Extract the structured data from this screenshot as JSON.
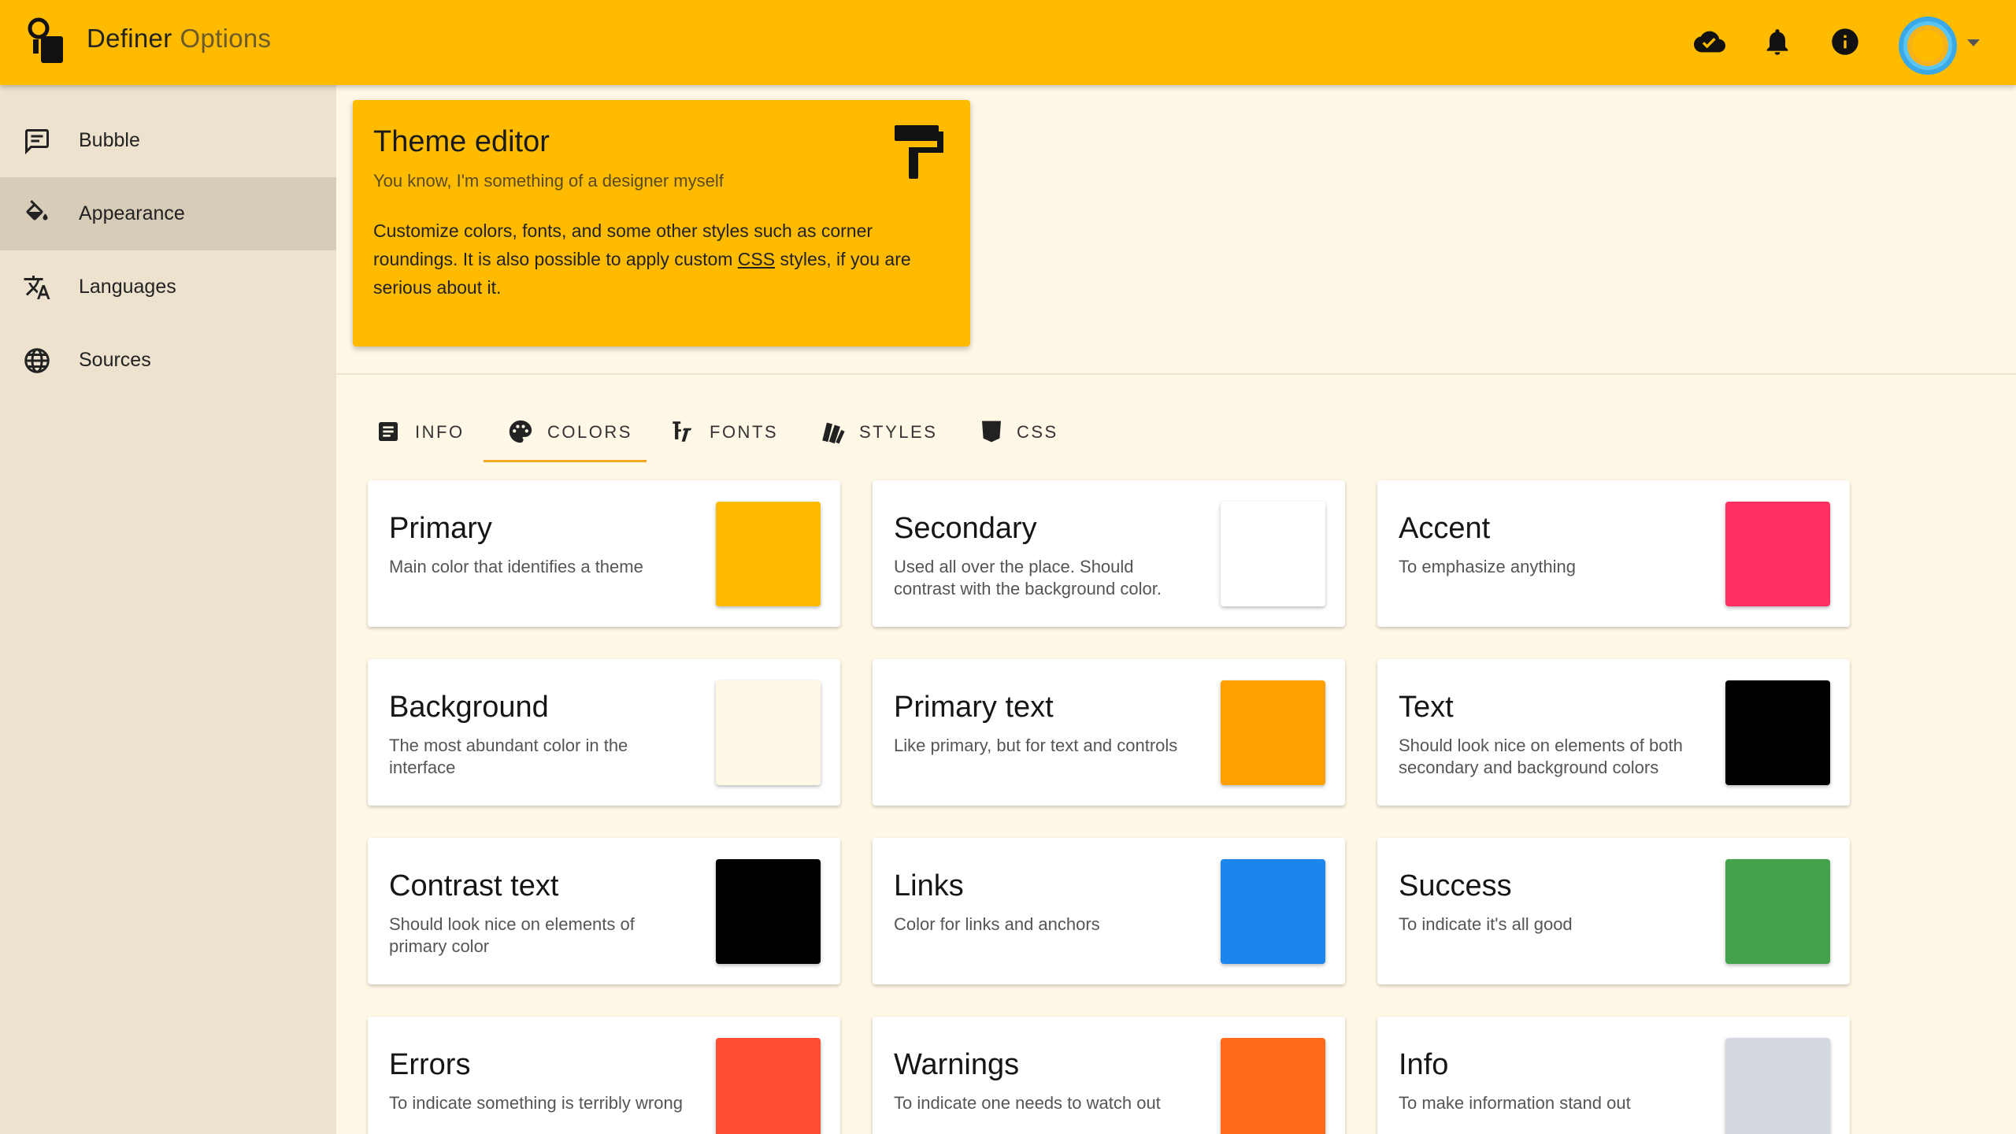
{
  "app": {
    "title_main": "Definer",
    "title_sub": "Options"
  },
  "appbar": {
    "icons": [
      "cloud-done-icon",
      "bell-icon",
      "info-icon"
    ],
    "avatar_colors": [
      "#F5B21B",
      "#3BA8E8"
    ]
  },
  "sidebar": {
    "items": [
      {
        "label": "Bubble",
        "icon": "chat-bubble-icon",
        "active": false
      },
      {
        "label": "Appearance",
        "icon": "paint-bucket-icon",
        "active": true
      },
      {
        "label": "Languages",
        "icon": "translate-icon",
        "active": false
      },
      {
        "label": "Sources",
        "icon": "globe-icon",
        "active": false
      }
    ]
  },
  "hero": {
    "title": "Theme editor",
    "subtitle": "You know, I'm something of a designer myself",
    "body_before": "Customize colors, fonts, and some other styles such as corner roundings. It is also possible to apply custom ",
    "body_link": "CSS",
    "body_after": " styles, if you are serious about it.",
    "icon": "paint-roller-icon"
  },
  "tabs": [
    {
      "label": "INFO",
      "icon": "article-icon",
      "active": false
    },
    {
      "label": "COLORS",
      "icon": "palette-icon",
      "active": true
    },
    {
      "label": "FONTS",
      "icon": "font-icon",
      "active": false
    },
    {
      "label": "STYLES",
      "icon": "swatchbook-icon",
      "active": false
    },
    {
      "label": "CSS",
      "icon": "css3-icon",
      "active": false
    }
  ],
  "colors": [
    {
      "name": "Primary",
      "description": "Main color that identifies a theme",
      "color": "#FFBB00"
    },
    {
      "name": "Secondary",
      "description": "Used all over the place. Should contrast with the background color.",
      "color": "#FFFFFF"
    },
    {
      "name": "Accent",
      "description": "To emphasize anything",
      "color": "#FF2E63"
    },
    {
      "name": "Background",
      "description": "The most abundant color in the interface",
      "color": "#FFF8E7"
    },
    {
      "name": "Primary text",
      "description": "Like primary, but for text and controls",
      "color": "#FF9F00"
    },
    {
      "name": "Text",
      "description": "Should look nice on elements of both secondary and background colors",
      "color": "#000000"
    },
    {
      "name": "Contrast text",
      "description": "Should look nice on elements of primary color",
      "color": "#000000"
    },
    {
      "name": "Links",
      "description": "Color for links and anchors",
      "color": "#1C86EE"
    },
    {
      "name": "Success",
      "description": "To indicate it's all good",
      "color": "#43A34A"
    },
    {
      "name": "Errors",
      "description": "To indicate something is terribly wrong",
      "color": "#FF4C33"
    },
    {
      "name": "Warnings",
      "description": "To indicate one needs to watch out",
      "color": "#FF6A1A"
    },
    {
      "name": "Info",
      "description": "To make information stand out",
      "color": "#D4D9E1"
    }
  ]
}
